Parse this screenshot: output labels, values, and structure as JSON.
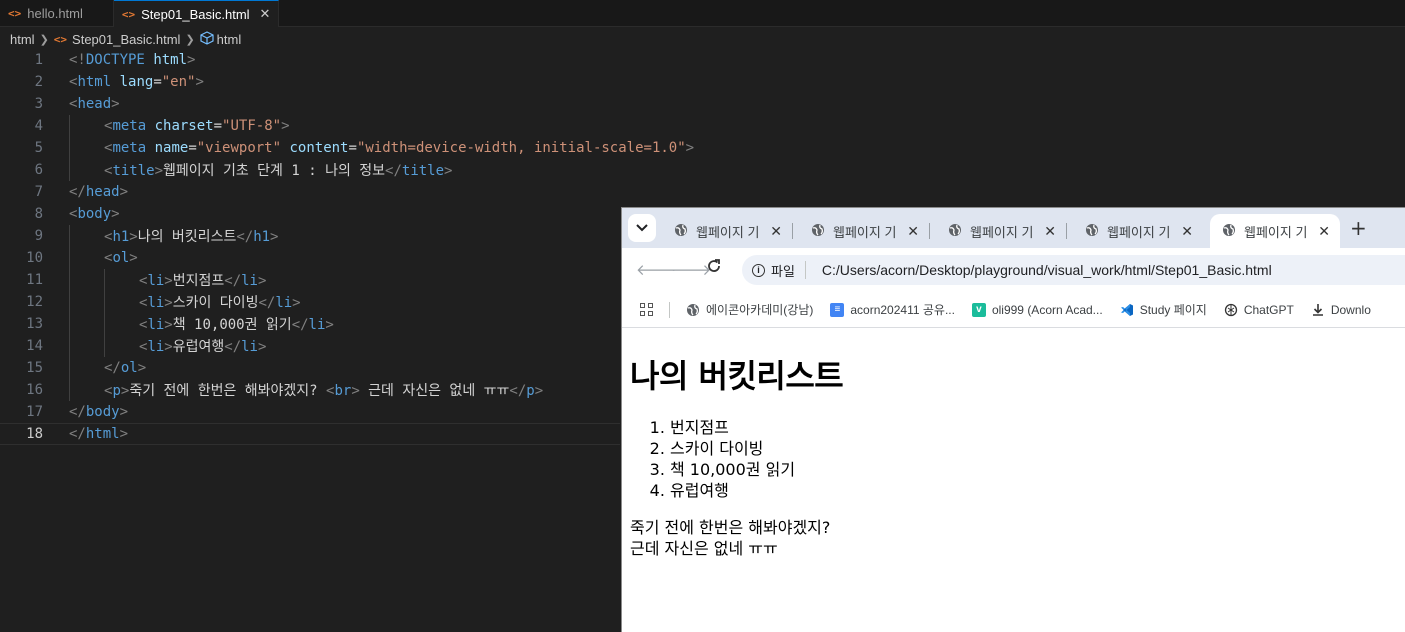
{
  "editor": {
    "tabs": [
      {
        "label": "hello.html",
        "active": false
      },
      {
        "label": "Step01_Basic.html",
        "active": true
      }
    ],
    "breadcrumb": [
      "html",
      "Step01_Basic.html",
      "html"
    ],
    "current_line": 18,
    "lines": [
      {
        "n": "1",
        "indent": 0,
        "tokens": [
          [
            "br",
            "<!"
          ],
          [
            "doc",
            "DOCTYPE"
          ],
          [
            "txt",
            " "
          ],
          [
            "attr",
            "html"
          ],
          [
            "br",
            ">"
          ]
        ]
      },
      {
        "n": "2",
        "indent": 0,
        "tokens": [
          [
            "br",
            "<"
          ],
          [
            "tag",
            "html"
          ],
          [
            "txt",
            " "
          ],
          [
            "attr",
            "lang"
          ],
          [
            "txt",
            "="
          ],
          [
            "str",
            "\"en\""
          ],
          [
            "br",
            ">"
          ]
        ]
      },
      {
        "n": "3",
        "indent": 0,
        "tokens": [
          [
            "br",
            "<"
          ],
          [
            "tag",
            "head"
          ],
          [
            "br",
            ">"
          ]
        ]
      },
      {
        "n": "4",
        "indent": 1,
        "tokens": [
          [
            "br",
            "<"
          ],
          [
            "tag",
            "meta"
          ],
          [
            "txt",
            " "
          ],
          [
            "attr",
            "charset"
          ],
          [
            "txt",
            "="
          ],
          [
            "str",
            "\"UTF-8\""
          ],
          [
            "br",
            ">"
          ]
        ]
      },
      {
        "n": "5",
        "indent": 1,
        "tokens": [
          [
            "br",
            "<"
          ],
          [
            "tag",
            "meta"
          ],
          [
            "txt",
            " "
          ],
          [
            "attr",
            "name"
          ],
          [
            "txt",
            "="
          ],
          [
            "str",
            "\"viewport\""
          ],
          [
            "txt",
            " "
          ],
          [
            "attr",
            "content"
          ],
          [
            "txt",
            "="
          ],
          [
            "str",
            "\"width=device-width, initial-scale=1.0\""
          ],
          [
            "br",
            ">"
          ]
        ]
      },
      {
        "n": "6",
        "indent": 1,
        "tokens": [
          [
            "br",
            "<"
          ],
          [
            "tag",
            "title"
          ],
          [
            "br",
            ">"
          ],
          [
            "txt",
            "웹페이지 기초 단계 1 : 나의 정보"
          ],
          [
            "br",
            "</"
          ],
          [
            "tag",
            "title"
          ],
          [
            "br",
            ">"
          ]
        ]
      },
      {
        "n": "7",
        "indent": 0,
        "tokens": [
          [
            "br",
            "</"
          ],
          [
            "tag",
            "head"
          ],
          [
            "br",
            ">"
          ]
        ]
      },
      {
        "n": "8",
        "indent": 0,
        "tokens": [
          [
            "br",
            "<"
          ],
          [
            "tag",
            "body"
          ],
          [
            "br",
            ">"
          ]
        ]
      },
      {
        "n": "9",
        "indent": 1,
        "tokens": [
          [
            "br",
            "<"
          ],
          [
            "tag",
            "h1"
          ],
          [
            "br",
            ">"
          ],
          [
            "txt",
            "나의 버킷리스트"
          ],
          [
            "br",
            "</"
          ],
          [
            "tag",
            "h1"
          ],
          [
            "br",
            ">"
          ]
        ]
      },
      {
        "n": "10",
        "indent": 1,
        "tokens": [
          [
            "br",
            "<"
          ],
          [
            "tag",
            "ol"
          ],
          [
            "br",
            ">"
          ]
        ]
      },
      {
        "n": "11",
        "indent": 2,
        "tokens": [
          [
            "br",
            "<"
          ],
          [
            "tag",
            "li"
          ],
          [
            "br",
            ">"
          ],
          [
            "txt",
            "번지점프"
          ],
          [
            "br",
            "</"
          ],
          [
            "tag",
            "li"
          ],
          [
            "br",
            ">"
          ]
        ]
      },
      {
        "n": "12",
        "indent": 2,
        "tokens": [
          [
            "br",
            "<"
          ],
          [
            "tag",
            "li"
          ],
          [
            "br",
            ">"
          ],
          [
            "txt",
            "스카이 다이빙"
          ],
          [
            "br",
            "</"
          ],
          [
            "tag",
            "li"
          ],
          [
            "br",
            ">"
          ]
        ]
      },
      {
        "n": "13",
        "indent": 2,
        "tokens": [
          [
            "br",
            "<"
          ],
          [
            "tag",
            "li"
          ],
          [
            "br",
            ">"
          ],
          [
            "txt",
            "책 10,000권 읽기"
          ],
          [
            "br",
            "</"
          ],
          [
            "tag",
            "li"
          ],
          [
            "br",
            ">"
          ]
        ]
      },
      {
        "n": "14",
        "indent": 2,
        "tokens": [
          [
            "br",
            "<"
          ],
          [
            "tag",
            "li"
          ],
          [
            "br",
            ">"
          ],
          [
            "txt",
            "유럽여행"
          ],
          [
            "br",
            "</"
          ],
          [
            "tag",
            "li"
          ],
          [
            "br",
            ">"
          ]
        ]
      },
      {
        "n": "15",
        "indent": 1,
        "tokens": [
          [
            "br",
            "</"
          ],
          [
            "tag",
            "ol"
          ],
          [
            "br",
            ">"
          ]
        ]
      },
      {
        "n": "16",
        "indent": 1,
        "tokens": [
          [
            "br",
            "<"
          ],
          [
            "tag",
            "p"
          ],
          [
            "br",
            ">"
          ],
          [
            "txt",
            "죽기 전에 한번은 해봐야겠지? "
          ],
          [
            "br",
            "<"
          ],
          [
            "tag",
            "br"
          ],
          [
            "br",
            ">"
          ],
          [
            "txt",
            " 근데 자신은 없네 ㅠㅠ"
          ],
          [
            "br",
            "</"
          ],
          [
            "tag",
            "p"
          ],
          [
            "br",
            ">"
          ]
        ]
      },
      {
        "n": "17",
        "indent": 0,
        "tokens": [
          [
            "br",
            "</"
          ],
          [
            "tag",
            "body"
          ],
          [
            "br",
            ">"
          ]
        ]
      },
      {
        "n": "18",
        "indent": 0,
        "tokens": [
          [
            "br",
            "</"
          ],
          [
            "tag",
            "html"
          ],
          [
            "br",
            ">"
          ]
        ]
      }
    ]
  },
  "browser": {
    "tabs": [
      {
        "title": "웹페이지 기",
        "active": false
      },
      {
        "title": "웹페이지 기",
        "active": false
      },
      {
        "title": "웹페이지 기",
        "active": false
      },
      {
        "title": "웹페이지 기",
        "active": false
      },
      {
        "title": "웹페이지 기",
        "active": true
      }
    ],
    "new_tab": "+",
    "site_chip": "파일",
    "url": "C:/Users/acorn/Desktop/playground/visual_work/html/Step01_Basic.html",
    "bookmarks": [
      {
        "label": "에이콘아카데미(강남)",
        "icon": "globe-icon"
      },
      {
        "label": "acorn202411 공유...",
        "icon": "docs-icon",
        "color": "#4285f4"
      },
      {
        "label": "oli999 (Acorn Acad...",
        "icon": "v-icon",
        "color": "#1bbc9b"
      },
      {
        "label": "Study 페이지",
        "icon": "vscode-icon",
        "color": "#0a66c2"
      },
      {
        "label": "ChatGPT",
        "icon": "chatgpt-icon"
      },
      {
        "label": "Downlo",
        "icon": "download-icon"
      }
    ],
    "page": {
      "heading": "나의 버킷리스트",
      "list": [
        "번지점프",
        "스카이 다이빙",
        "책 10,000권 읽기",
        "유럽여행"
      ],
      "para_line1": "죽기 전에 한번은 해봐야겠지?",
      "para_line2": "근데 자신은 없네 ㅠㅠ"
    }
  }
}
